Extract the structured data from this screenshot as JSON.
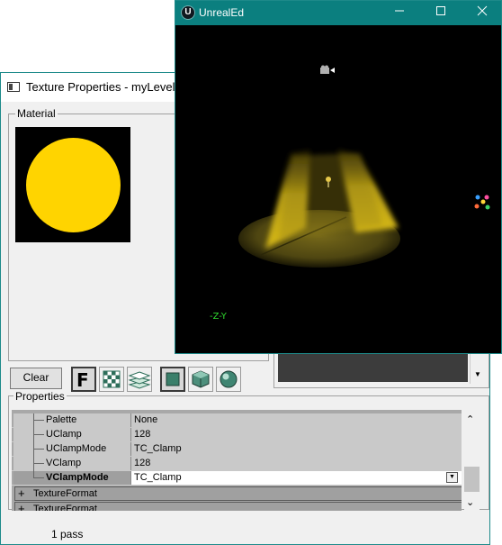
{
  "texture_window": {
    "title": "Texture Properties - myLevel.Pro",
    "material_group_label": "Material",
    "material_color": "#ffd400",
    "clear_button_label": "Clear",
    "font_button_glyph": "F",
    "toolbar_icons": [
      "font-icon",
      "checker-icon",
      "layers-icon",
      "flat-square-icon",
      "cube-icon",
      "sphere-icon"
    ],
    "properties_group_label": "Properties",
    "properties": [
      {
        "name": "Palette",
        "value": "None"
      },
      {
        "name": "UClamp",
        "value": "128"
      },
      {
        "name": "UClampMode",
        "value": "TC_Clamp"
      },
      {
        "name": "VClamp",
        "value": "128"
      },
      {
        "name": "VClampMode",
        "value": "TC_Clamp",
        "selected": true
      }
    ],
    "categories": [
      "TextureFormat",
      "TextureFormat"
    ],
    "status": "1 pass"
  },
  "unrealed_window": {
    "title": "UnrealEd",
    "axis_label": "-Z-Y",
    "spotlight_color": "#ffd21e"
  }
}
